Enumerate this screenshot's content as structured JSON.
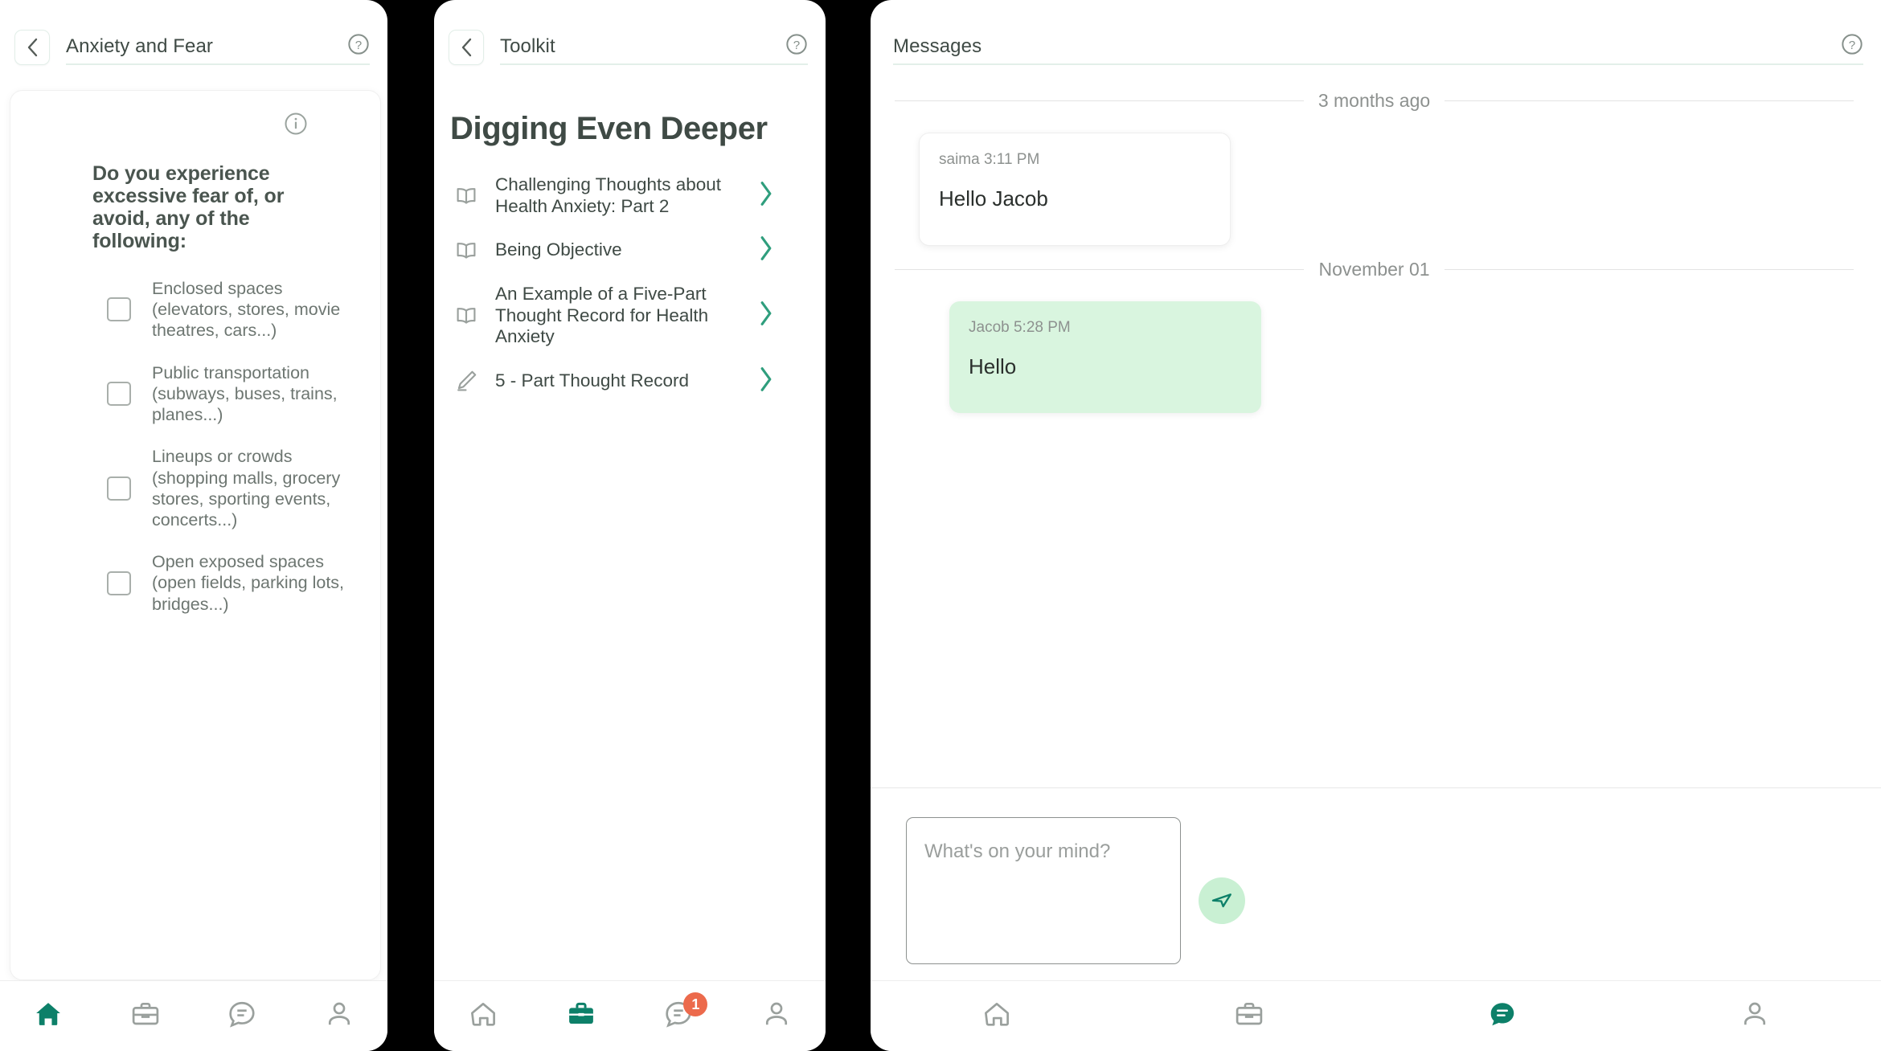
{
  "panels": {
    "left": {
      "header": {
        "title": "Anxiety and Fear",
        "back_icon": "chevron-left-icon",
        "help_icon": "question-circle-icon"
      },
      "card": {
        "info_icon": "info-circle-icon",
        "question": "Do you experience excessive fear of, or avoid, any of the following:",
        "options": [
          {
            "label": "Enclosed spaces (elevators, stores, movie theatres, cars...)",
            "checked": false
          },
          {
            "label": "Public transportation (subways, buses, trains, planes...)",
            "checked": false
          },
          {
            "label": "Lineups or crowds (shopping malls, grocery stores, sporting events, concerts...)",
            "checked": false
          },
          {
            "label": "Open exposed spaces (open fields, parking lots, bridges...)",
            "checked": false
          }
        ]
      },
      "bottom_nav": [
        {
          "icon": "home-icon",
          "active": true,
          "badge": null
        },
        {
          "icon": "toolkit-briefcase-icon",
          "active": false,
          "badge": null
        },
        {
          "icon": "message-chat-icon",
          "active": false,
          "badge": null
        },
        {
          "icon": "profile-person-icon",
          "active": false,
          "badge": null
        }
      ]
    },
    "middle": {
      "header": {
        "title": "Toolkit",
        "back_icon": "chevron-left-icon",
        "help_icon": "question-circle-icon"
      },
      "section_title": "Digging Even Deeper",
      "items": [
        {
          "icon": "book-icon",
          "label": "Challenging Thoughts about Health Anxiety: Part 2",
          "chevron": "chevron-right-icon"
        },
        {
          "icon": "book-icon",
          "label": "Being Objective",
          "chevron": "chevron-right-icon"
        },
        {
          "icon": "book-icon",
          "label": "An Example of a Five-Part Thought Record for Health Anxiety",
          "chevron": "chevron-right-icon"
        },
        {
          "icon": "pencil-edit-icon",
          "label": "5 - Part Thought Record",
          "chevron": "chevron-right-icon"
        }
      ],
      "bottom_nav": [
        {
          "icon": "home-icon",
          "active": false,
          "badge": null
        },
        {
          "icon": "toolkit-briefcase-icon",
          "active": true,
          "badge": null
        },
        {
          "icon": "message-chat-icon",
          "active": false,
          "badge": "1"
        },
        {
          "icon": "profile-person-icon",
          "active": false,
          "badge": null
        }
      ]
    },
    "right": {
      "header": {
        "title": "Messages",
        "help_icon": "question-circle-icon"
      },
      "threads": [
        {
          "separator": "3 months ago",
          "message": {
            "meta": "saima 3:11 PM",
            "text": "Hello Jacob",
            "mine": false
          }
        },
        {
          "separator": "November 01",
          "message": {
            "meta": "Jacob 5:28 PM",
            "text": "Hello",
            "mine": true
          }
        }
      ],
      "composer": {
        "placeholder": "What's on your mind?",
        "value": "",
        "send_icon": "send-paper-plane-icon"
      },
      "bottom_nav": [
        {
          "icon": "home-icon",
          "active": false,
          "badge": null
        },
        {
          "icon": "toolkit-briefcase-icon",
          "active": false,
          "badge": null
        },
        {
          "icon": "message-chat-icon",
          "active": true,
          "badge": null
        },
        {
          "icon": "profile-person-icon",
          "active": false,
          "badge": null
        }
      ]
    }
  },
  "colors": {
    "accent_teal": "#0d8069",
    "badge_orange": "#ec6a4c",
    "bubble_green": "#d9f5df",
    "send_bg": "#c9f0d3",
    "muted": "#8d918f"
  }
}
